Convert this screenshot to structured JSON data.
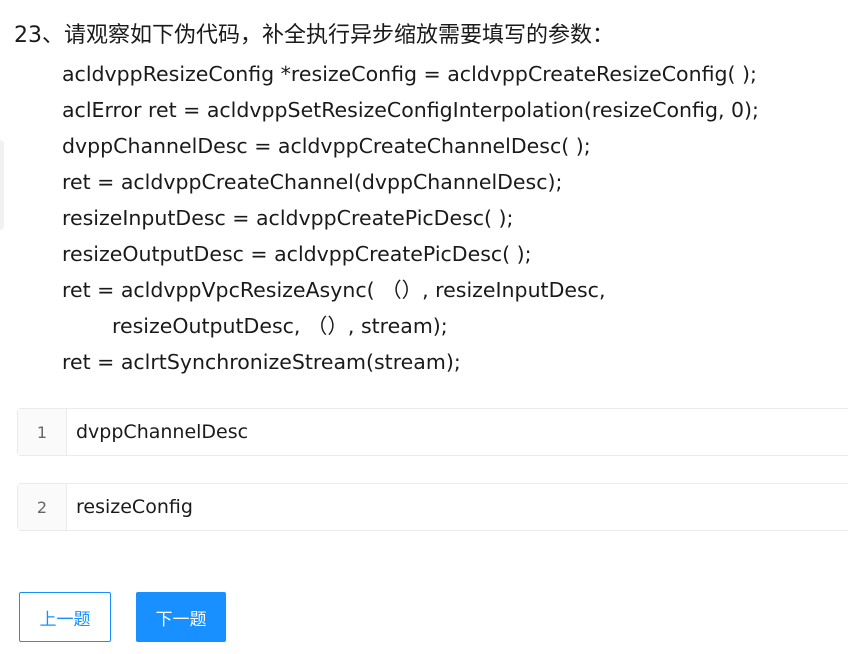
{
  "question": {
    "title": "23、请观察如下伪代码，补全执行异步缩放需要填写的参数：",
    "code_lines": [
      "acldvppResizeConfig *resizeConfig = acldvppCreateResizeConfig( );",
      "aclError ret = acldvppSetResizeConfigInterpolation(resizeConfig, 0);",
      "dvppChannelDesc = acldvppCreateChannelDesc( );",
      "ret = acldvppCreateChannel(dvppChannelDesc);",
      "resizeInputDesc = acldvppCreatePicDesc( );",
      "resizeOutputDesc = acldvppCreatePicDesc( );",
      "ret = acldvppVpcResizeAsync( （）, resizeInputDesc,",
      "resizeOutputDesc, （）, stream);",
      "ret = aclrtSynchronizeStream(stream);"
    ]
  },
  "answers": [
    {
      "number": "1",
      "value": "dvppChannelDesc"
    },
    {
      "number": "2",
      "value": "resizeConfig"
    }
  ],
  "navigation": {
    "prev_label": "上一题",
    "next_label": "下一题"
  },
  "colors": {
    "accent": "#1890ff"
  }
}
